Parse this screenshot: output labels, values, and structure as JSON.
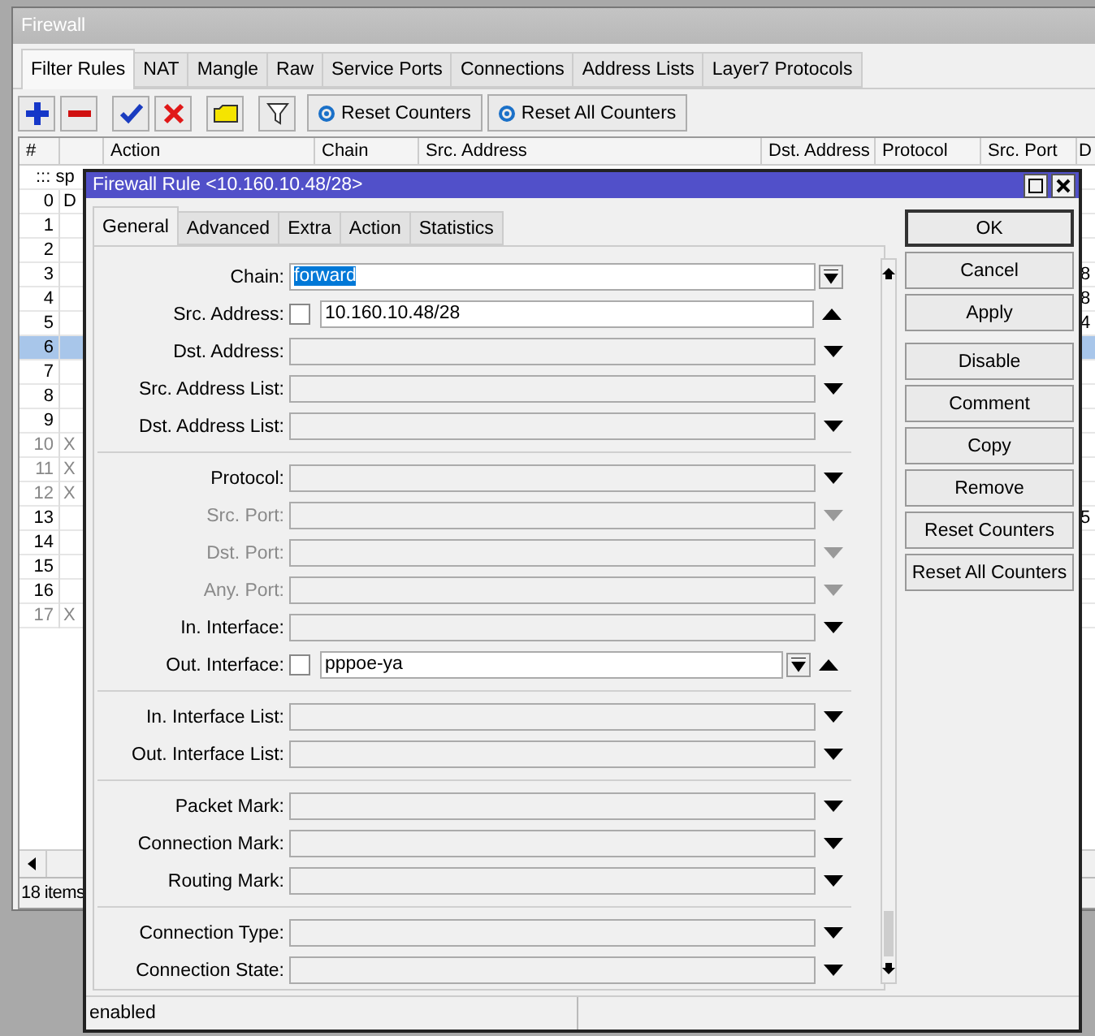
{
  "window": {
    "title": "Firewall"
  },
  "tabs": [
    {
      "label": "Filter Rules",
      "selected": true
    },
    {
      "label": "NAT",
      "selected": false
    },
    {
      "label": "Mangle",
      "selected": false
    },
    {
      "label": "Raw",
      "selected": false
    },
    {
      "label": "Service Ports",
      "selected": false
    },
    {
      "label": "Connections",
      "selected": false
    },
    {
      "label": "Address Lists",
      "selected": false
    },
    {
      "label": "Layer7 Protocols",
      "selected": false
    }
  ],
  "toolbar": {
    "buttons": [
      "Reset Counters",
      "Reset All Counters"
    ]
  },
  "table": {
    "columns": [
      "#",
      "Action",
      "Chain",
      "Src. Address",
      "Dst. Address",
      "Protocol",
      "Src. Port",
      "D"
    ],
    "rows": [
      {
        "kind": "comment",
        "comment": "::: sp"
      },
      {
        "kind": "rule",
        "num": "0",
        "flag": "D",
        "disabled": false,
        "selected": false
      },
      {
        "kind": "rule",
        "num": "1",
        "disabled": false,
        "selected": false
      },
      {
        "kind": "rule",
        "num": "2",
        "disabled": false,
        "selected": false
      },
      {
        "kind": "rule",
        "num": "3",
        "disabled": false,
        "selected": false,
        "column_8": "8"
      },
      {
        "kind": "rule",
        "num": "4",
        "disabled": false,
        "selected": false,
        "column_8": "8"
      },
      {
        "kind": "rule",
        "num": "5",
        "disabled": false,
        "selected": false,
        "column_8": "4"
      },
      {
        "kind": "rule",
        "num": "6",
        "disabled": false,
        "selected": true
      },
      {
        "kind": "rule",
        "num": "7",
        "disabled": false,
        "selected": false
      },
      {
        "kind": "rule",
        "num": "8",
        "disabled": false,
        "selected": false
      },
      {
        "kind": "rule",
        "num": "9",
        "disabled": false,
        "selected": false
      },
      {
        "kind": "rule",
        "num": "10",
        "flag": "X",
        "disabled": true,
        "selected": false
      },
      {
        "kind": "rule",
        "num": "11",
        "flag": "X",
        "disabled": true,
        "selected": false
      },
      {
        "kind": "rule",
        "num": "12",
        "flag": "X",
        "disabled": true,
        "selected": false
      },
      {
        "kind": "rule",
        "num": "13",
        "disabled": false,
        "selected": false,
        "column_8": "5"
      },
      {
        "kind": "rule",
        "num": "14",
        "disabled": false,
        "selected": false
      },
      {
        "kind": "rule",
        "num": "15",
        "disabled": false,
        "selected": false
      },
      {
        "kind": "rule",
        "num": "16",
        "disabled": false,
        "selected": false
      },
      {
        "kind": "rule",
        "num": "17",
        "flag": "X",
        "disabled": true,
        "selected": false
      }
    ]
  },
  "status_bar": "18 items",
  "dialog": {
    "title": "Firewall Rule <10.160.10.48/28>",
    "tabs": [
      {
        "label": "General",
        "selected": true
      },
      {
        "label": "Advanced",
        "selected": false
      },
      {
        "label": "Extra",
        "selected": false
      },
      {
        "label": "Action",
        "selected": false
      },
      {
        "label": "Statistics",
        "selected": false
      }
    ],
    "groups": [
      [
        {
          "label": "Chain:",
          "kind": "combo",
          "value": "forward",
          "value_selected": true
        },
        {
          "label": "Src. Address:",
          "kind": "negatable",
          "value": "10.160.10.48/28",
          "checked": false,
          "list_button": false,
          "expanded": true
        },
        {
          "label": "Dst. Address:",
          "kind": "empty",
          "disabled": false,
          "expanded": false
        },
        {
          "label": "Src. Address List:",
          "kind": "empty",
          "disabled": false,
          "expanded": false
        },
        {
          "label": "Dst. Address List:",
          "kind": "empty",
          "disabled": false,
          "expanded": false
        }
      ],
      [
        {
          "label": "Protocol:",
          "kind": "empty",
          "disabled": false,
          "expanded": false
        },
        {
          "label": "Src. Port:",
          "kind": "empty",
          "disabled": true,
          "expanded": false
        },
        {
          "label": "Dst. Port:",
          "kind": "empty",
          "disabled": true,
          "expanded": false
        },
        {
          "label": "Any. Port:",
          "kind": "empty",
          "disabled": true,
          "expanded": false
        },
        {
          "label": "In. Interface:",
          "kind": "empty",
          "disabled": false,
          "expanded": false
        },
        {
          "label": "Out. Interface:",
          "kind": "negatable",
          "value": "pppoe-ya",
          "checked": false,
          "list_button": true,
          "expanded": true
        }
      ],
      [
        {
          "label": "In. Interface List:",
          "kind": "empty",
          "disabled": false,
          "expanded": false
        },
        {
          "label": "Out. Interface List:",
          "kind": "empty",
          "disabled": false,
          "expanded": false
        }
      ],
      [
        {
          "label": "Packet Mark:",
          "kind": "empty",
          "disabled": false,
          "expanded": false
        },
        {
          "label": "Connection Mark:",
          "kind": "empty",
          "disabled": false,
          "expanded": false
        },
        {
          "label": "Routing Mark:",
          "kind": "empty",
          "disabled": false,
          "expanded": false
        }
      ],
      [
        {
          "label": "Connection Type:",
          "kind": "empty",
          "disabled": false,
          "expanded": false
        },
        {
          "label": "Connection State:",
          "kind": "empty",
          "disabled": false,
          "expanded": false
        }
      ]
    ],
    "button_groups": [
      [
        {
          "label": "OK",
          "default": true
        },
        {
          "label": "Cancel",
          "default": false
        },
        {
          "label": "Apply",
          "default": false
        }
      ],
      [
        {
          "label": "Disable",
          "default": false
        },
        {
          "label": "Comment",
          "default": false
        },
        {
          "label": "Copy",
          "default": false
        },
        {
          "label": "Remove",
          "default": false
        },
        {
          "label": "Reset Counters",
          "default": false
        },
        {
          "label": "Reset All Counters",
          "default": false
        }
      ]
    ],
    "status": "enabled"
  }
}
